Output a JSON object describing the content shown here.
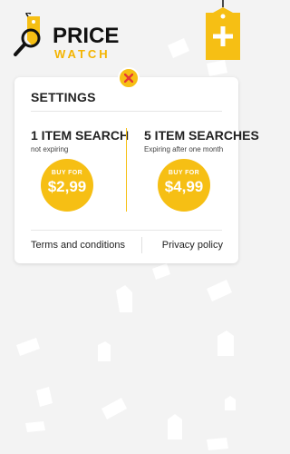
{
  "app": {
    "brand_line1": "PRICE",
    "brand_line2": "WATCH",
    "accent_color": "#f6bf14",
    "logo_icon": "search-tag-icon",
    "add_icon": "plus-tag-icon"
  },
  "settings": {
    "title": "SETTINGS",
    "close_icon": "close-icon",
    "plans": [
      {
        "title": "1 ITEM SEARCH",
        "subtitle": "not expiring",
        "buy_label": "BUY FOR",
        "price": "$2,99"
      },
      {
        "title": "5 ITEM SEARCHES",
        "subtitle": "Expiring after one month",
        "buy_label": "BUY FOR",
        "price": "$4,99"
      }
    ],
    "links": {
      "terms": "Terms and conditions",
      "privacy": "Privacy policy"
    }
  }
}
